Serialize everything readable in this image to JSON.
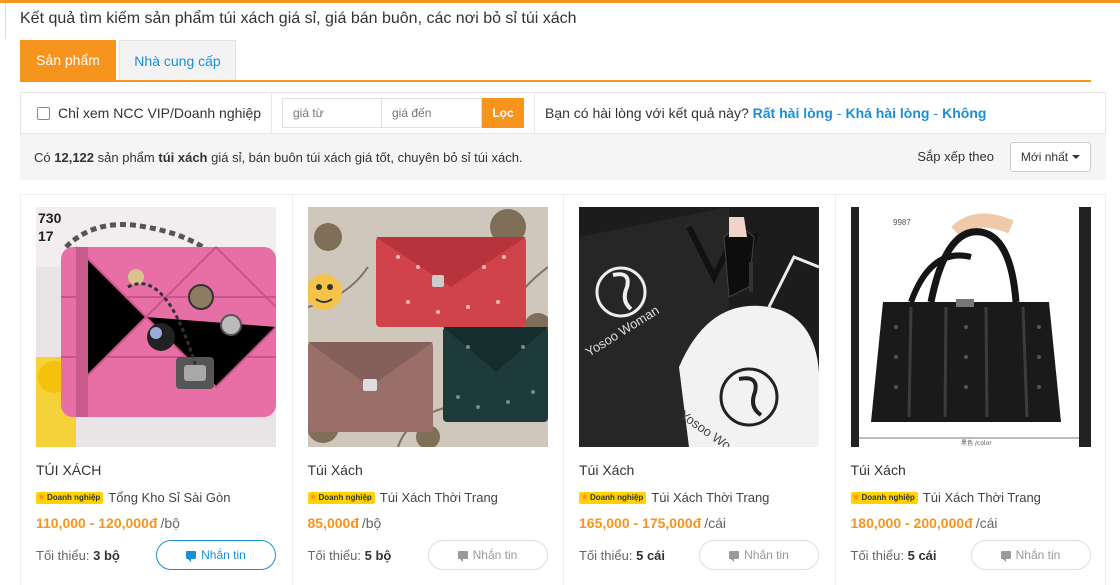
{
  "header": {
    "page_title": "Kết quả tìm kiếm sản phẩm túi xách giá sỉ, giá bán buôn, các nơi bỏ sỉ túi xách"
  },
  "tabs": [
    {
      "label": "Sản phẩm",
      "active": true
    },
    {
      "label": "Nhà cung cấp",
      "active": false
    }
  ],
  "filters": {
    "vip_label": "Chỉ xem NCC VIP/Doanh nghiệp",
    "vip_checked": false,
    "price_from_placeholder": "giá từ",
    "price_to_placeholder": "giá đến",
    "filter_button": "Lọc",
    "satisfaction_question": "Bạn có hài lòng với kết quả này?",
    "satisfaction_options": [
      "Rất hài lòng",
      "Khá hài lòng",
      "Không"
    ],
    "separator": "-"
  },
  "results": {
    "prefix": "Có",
    "count": "12,122",
    "middle": "sản phẩm",
    "keyword": "túi xách",
    "suffix": "giá sỉ, bán buôn túi xách giá tốt, chuyên bỏ sỉ túi xách.",
    "sort_label": "Sắp xếp theo",
    "sort_value": "Mới nhất"
  },
  "products": [
    {
      "title": "TÚI XÁCH",
      "badge": "Doanh nghiệp",
      "supplier": "Tổng Kho Sỉ Sài Gòn",
      "price": "110,000 - 120,000đ",
      "unit": "/bộ",
      "min_label": "Tối thiểu:",
      "min_value": "3 bộ",
      "message_label": "Nhắn tin"
    },
    {
      "title": "Túi Xách",
      "badge": "Doanh nghiệp",
      "supplier": "Túi Xách Thời Trang",
      "price": "85,000đ",
      "unit": "/bộ",
      "min_label": "Tối thiểu:",
      "min_value": "5 bộ",
      "message_label": "Nhắn tin"
    },
    {
      "title": "Túi Xách",
      "badge": "Doanh nghiệp",
      "supplier": "Túi Xách Thời Trang",
      "price": "165,000 - 175,000đ",
      "unit": "/cái",
      "min_label": "Tối thiểu:",
      "min_value": "5 cái",
      "message_label": "Nhắn tin"
    },
    {
      "title": "Túi Xách",
      "badge": "Doanh nghiệp",
      "supplier": "Túi Xách Thời Trang",
      "price": "180,000 - 200,000đ",
      "unit": "/cái",
      "min_label": "Tối thiểu:",
      "min_value": "5 cái",
      "message_label": "Nhắn tin"
    }
  ],
  "image_text": {
    "p1_code_a": "730",
    "p1_code_b": "17",
    "p3_brand": "Yosoo Woman",
    "p3_brand_b": "Yosoo Wo",
    "p4_code": "9987",
    "p4_color": "黑色 /color"
  },
  "colors": {
    "accent": "#f7941d",
    "link": "#1a8fd6",
    "badge": "#ffd200"
  }
}
